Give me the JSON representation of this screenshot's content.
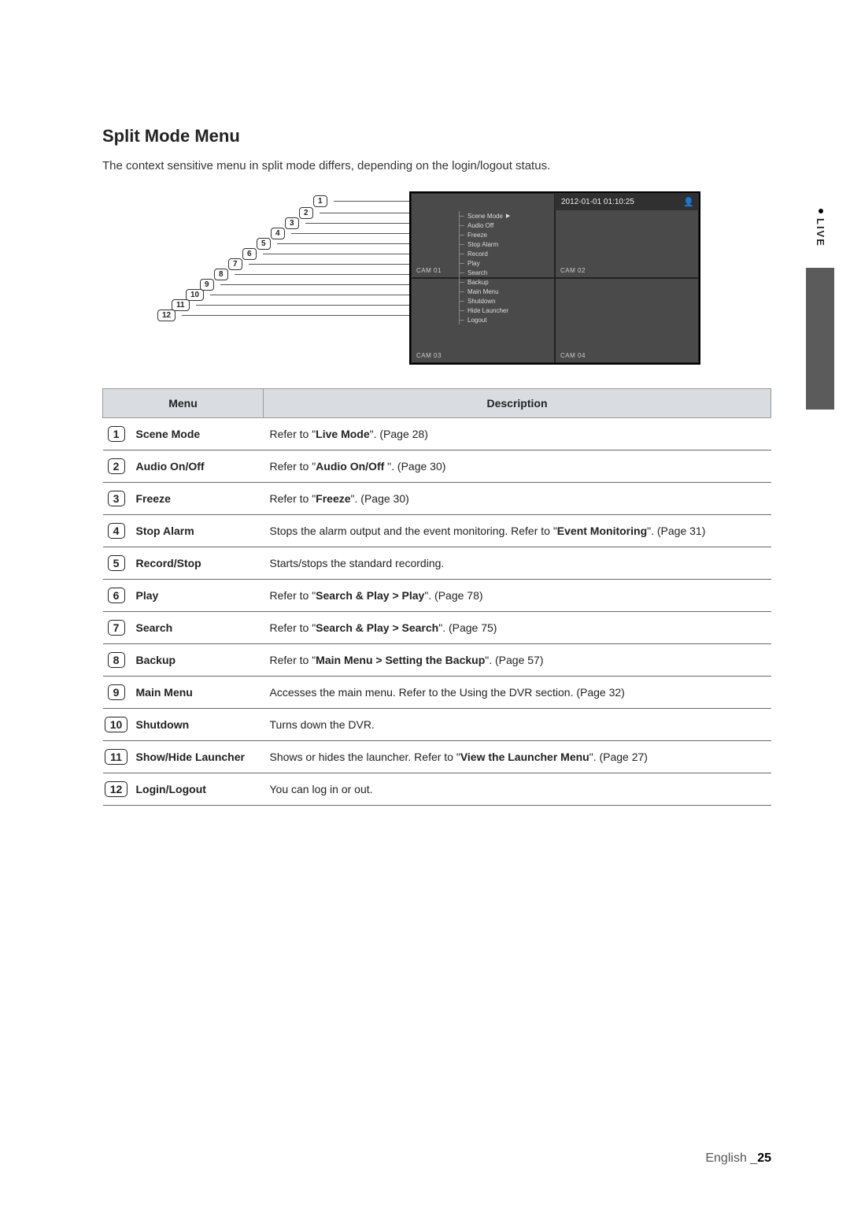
{
  "heading": "Split Mode Menu",
  "intro": "The context sensitive menu in split mode differs, depending on the login/logout status.",
  "screenshot": {
    "datetime": "2012-01-01 01:10:25",
    "cams": [
      "CAM 01",
      "CAM 02",
      "CAM 03",
      "CAM 04"
    ],
    "context_menu": [
      "Scene Mode",
      "Audio Off",
      "Freeze",
      "Stop Alarm",
      "Record",
      "Play",
      "Search",
      "Backup",
      "Main Menu",
      "Shutdown",
      "Hide Launcher",
      "Logout"
    ]
  },
  "table_headers": {
    "menu": "Menu",
    "description": "Description"
  },
  "rows": [
    {
      "n": "1",
      "name": "Scene Mode",
      "d_pre": "Refer to \"",
      "d_b": "Live Mode",
      "d_post": "\". (Page 28)"
    },
    {
      "n": "2",
      "name": "Audio On/Off",
      "d_pre": "Refer to \"",
      "d_b": "Audio On/Off",
      "d_post": " \". (Page 30)"
    },
    {
      "n": "3",
      "name": "Freeze",
      "d_pre": "Refer to \"",
      "d_b": "Freeze",
      "d_post": "\". (Page 30)"
    },
    {
      "n": "4",
      "name": "Stop Alarm",
      "d_pre": "Stops the alarm output and the event monitoring. Refer to \"",
      "d_b": "Event Monitoring",
      "d_post": "\". (Page 31)"
    },
    {
      "n": "5",
      "name": "Record/Stop",
      "d_pre": "Starts/stops the standard recording.",
      "d_b": "",
      "d_post": ""
    },
    {
      "n": "6",
      "name": "Play",
      "d_pre": "Refer to \"",
      "d_b": "Search & Play > Play",
      "d_post": "\". (Page 78)"
    },
    {
      "n": "7",
      "name": "Search",
      "d_pre": "Refer to \"",
      "d_b": "Search & Play > Search",
      "d_post": "\". (Page 75)"
    },
    {
      "n": "8",
      "name": "Backup",
      "d_pre": "Refer to \"",
      "d_b": "Main Menu > Setting the Backup",
      "d_post": "\". (Page 57)"
    },
    {
      "n": "9",
      "name": "Main Menu",
      "d_pre": "Accesses the main menu. Refer to the Using the DVR section. (Page 32)",
      "d_b": "",
      "d_post": ""
    },
    {
      "n": "10",
      "name": "Shutdown",
      "d_pre": "Turns down the DVR.",
      "d_b": "",
      "d_post": ""
    },
    {
      "n": "11",
      "name": "Show/Hide Launcher",
      "d_pre": "Shows or hides the launcher. Refer to \"",
      "d_b": "View the Launcher Menu",
      "d_post": "\". (Page 27)"
    },
    {
      "n": "12",
      "name": "Login/Logout",
      "d_pre": "You can log in or out.",
      "d_b": "",
      "d_post": ""
    }
  ],
  "side_tab": "LIVE",
  "footer": {
    "lang": "English",
    "sep": "_",
    "page": "25"
  }
}
